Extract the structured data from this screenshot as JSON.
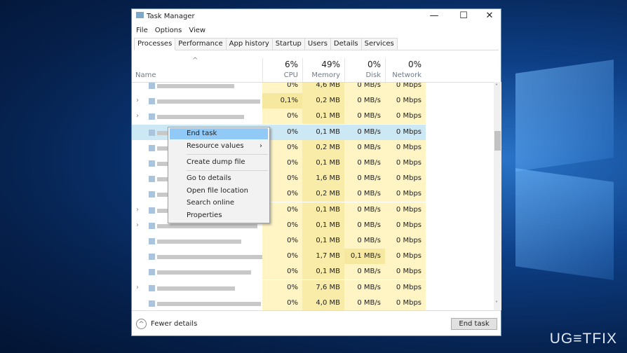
{
  "window": {
    "title": "Task Manager",
    "minimize": "—",
    "maximize": "☐",
    "close": "✕"
  },
  "menu": [
    "File",
    "Options",
    "View"
  ],
  "tabs": [
    "Processes",
    "Performance",
    "App history",
    "Startup",
    "Users",
    "Details",
    "Services"
  ],
  "columns": [
    {
      "pct": "6%",
      "label": "CPU"
    },
    {
      "pct": "49%",
      "label": "Memory"
    },
    {
      "pct": "0%",
      "label": "Disk"
    },
    {
      "pct": "0%",
      "label": "Network"
    }
  ],
  "name_header": "Name",
  "rows": [
    {
      "cpu": "0%",
      "mem": "4,6 MB",
      "disk": "0 MB/s",
      "net": "0 Mbps",
      "exp": false
    },
    {
      "cpu": "0,1%",
      "mem": "0,2 MB",
      "disk": "0 MB/s",
      "net": "0 Mbps",
      "exp": true
    },
    {
      "cpu": "0%",
      "mem": "0,1 MB",
      "disk": "0 MB/s",
      "net": "0 Mbps",
      "exp": true
    },
    {
      "cpu": "0%",
      "mem": "0,1 MB",
      "disk": "0 MB/s",
      "net": "0 Mbps",
      "exp": false,
      "selected": true
    },
    {
      "cpu": "0%",
      "mem": "0,2 MB",
      "disk": "0 MB/s",
      "net": "0 Mbps",
      "exp": false
    },
    {
      "cpu": "0%",
      "mem": "0,1 MB",
      "disk": "0 MB/s",
      "net": "0 Mbps",
      "exp": false
    },
    {
      "cpu": "0%",
      "mem": "1,6 MB",
      "disk": "0 MB/s",
      "net": "0 Mbps",
      "exp": false
    },
    {
      "cpu": "0%",
      "mem": "0,2 MB",
      "disk": "0 MB/s",
      "net": "0 Mbps",
      "exp": false
    },
    {
      "cpu": "0%",
      "mem": "0,1 MB",
      "disk": "0 MB/s",
      "net": "0 Mbps",
      "exp": true
    },
    {
      "cpu": "0%",
      "mem": "0,1 MB",
      "disk": "0 MB/s",
      "net": "0 Mbps",
      "exp": true
    },
    {
      "cpu": "0%",
      "mem": "0,1 MB",
      "disk": "0 MB/s",
      "net": "0 Mbps",
      "exp": false
    },
    {
      "cpu": "0%",
      "mem": "1,7 MB",
      "disk": "0,1 MB/s",
      "net": "0 Mbps",
      "exp": false
    },
    {
      "cpu": "0%",
      "mem": "0,1 MB",
      "disk": "0 MB/s",
      "net": "0 Mbps",
      "exp": false
    },
    {
      "cpu": "0%",
      "mem": "7,6 MB",
      "disk": "0 MB/s",
      "net": "0 Mbps",
      "exp": true
    },
    {
      "cpu": "0%",
      "mem": "4,0 MB",
      "disk": "0 MB/s",
      "net": "0 Mbps",
      "exp": false
    }
  ],
  "context_menu": {
    "items": [
      "End task",
      "Resource values",
      "Create dump file",
      "Go to details",
      "Open file location",
      "Search online",
      "Properties"
    ],
    "submenu_arrow": "›"
  },
  "footer": {
    "fewer_details": "Fewer details",
    "end_task": "End task"
  },
  "watermark": "UG≡TFIX",
  "colors": {
    "heat_light": "#fff4c4",
    "heat_mid": "#f9eca8",
    "selected": "#cce8f4",
    "menu_highlight": "#91c9f7"
  }
}
